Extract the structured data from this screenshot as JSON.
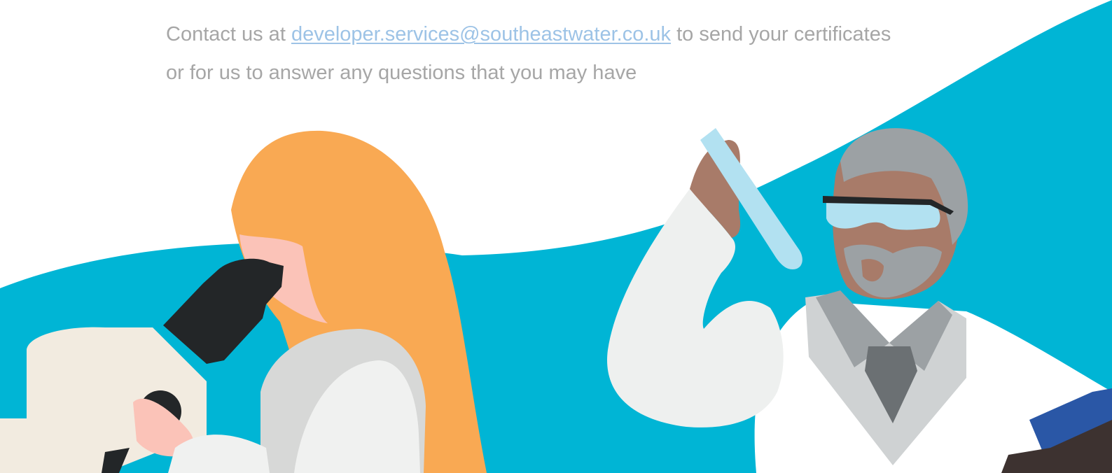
{
  "contact": {
    "intro": "Contact us at",
    "email": "developer.services@southeastwater.co.uk",
    "outro": "to send your certificates",
    "line2": "or for us to answer any questions that you may have"
  },
  "illustration": {
    "accent_color": "#00b5d5",
    "icons": [
      "scientist-microscope-illustration",
      "scientist-test-tube-illustration"
    ]
  }
}
